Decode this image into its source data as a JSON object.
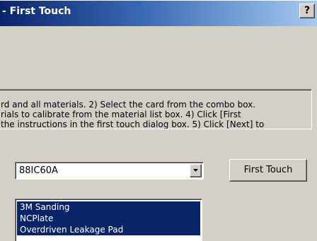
{
  "window": {
    "title": "- First Touch",
    "help_label": "?"
  },
  "instructions": {
    "lines": [
      "rd and all materials.  2) Select the card from the combo box.",
      "rials to calibrate from the material list box.  4) Click [First",
      " the instructions in the first touch dialog box.  5) Click [Next] to"
    ]
  },
  "card_combo": {
    "selected": "88IC60A"
  },
  "first_touch_button": {
    "label": "First Touch"
  },
  "material_list": {
    "items": [
      {
        "label": "3M Sanding",
        "selected": true
      },
      {
        "label": "NCPlate",
        "selected": true
      },
      {
        "label": "Overdriven Leakage Pad",
        "selected": true
      }
    ]
  },
  "colors": {
    "face": "#d4d0c8",
    "title_start": "#0a246a",
    "title_end": "#a6caf0",
    "selection": "#0a246a"
  }
}
